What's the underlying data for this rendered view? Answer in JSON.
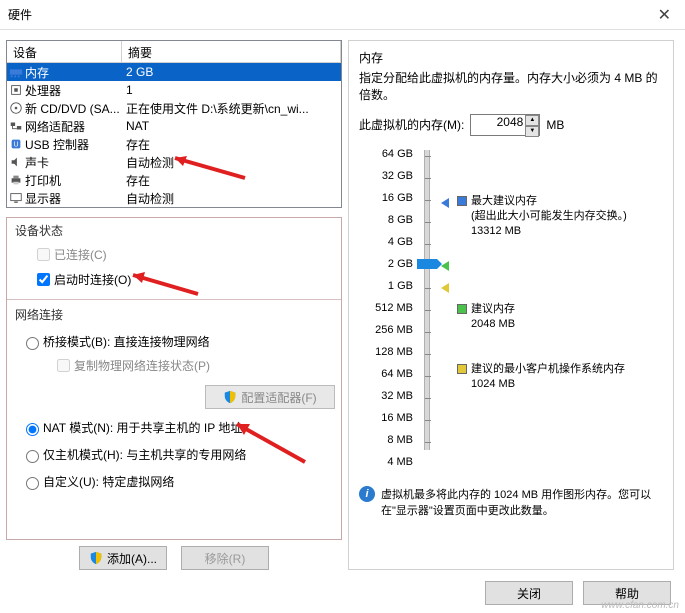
{
  "window": {
    "title": "硬件"
  },
  "device_table": {
    "col_device": "设备",
    "col_summary": "摘要",
    "rows": [
      {
        "icon": "ram",
        "device": "内存",
        "summary": "2 GB",
        "selected": true
      },
      {
        "icon": "cpu",
        "device": "处理器",
        "summary": "1"
      },
      {
        "icon": "cd",
        "device": "新 CD/DVD (SA...",
        "summary": "正在使用文件 D:\\系统更新\\cn_wi..."
      },
      {
        "icon": "net",
        "device": "网络适配器",
        "summary": "NAT"
      },
      {
        "icon": "usb",
        "device": "USB 控制器",
        "summary": "存在"
      },
      {
        "icon": "sound",
        "device": "声卡",
        "summary": "自动检测"
      },
      {
        "icon": "printer",
        "device": "打印机",
        "summary": "存在"
      },
      {
        "icon": "display",
        "device": "显示器",
        "summary": "自动检测"
      }
    ]
  },
  "status": {
    "group": "设备状态",
    "connected": "已连接(C)",
    "connect_on_start": "启动时连接(O)",
    "net_group": "网络连接",
    "bridge": "桥接模式(B): 直接连接物理网络",
    "replicate": "复制物理网络连接状态(P)",
    "config_adapter": "配置适配器(F)",
    "nat": "NAT 模式(N): 用于共享主机的 IP 地址",
    "hostonly": "仅主机模式(H): 与主机共享的专用网络",
    "custom": "自定义(U): 特定虚拟网络"
  },
  "memory": {
    "header": "内存",
    "desc": "指定分配给此虚拟机的内存量。内存大小必须为 4 MB 的倍数。",
    "label": "此虚拟机的内存(M):",
    "value": "2048",
    "unit": "MB",
    "ticks": [
      {
        "label": "64 GB"
      },
      {
        "label": "32 GB"
      },
      {
        "label": "16 GB"
      },
      {
        "label": "8 GB"
      },
      {
        "label": "4 GB"
      },
      {
        "label": "2 GB"
      },
      {
        "label": "1 GB"
      },
      {
        "label": "512 MB"
      },
      {
        "label": "256 MB"
      },
      {
        "label": "128 MB"
      },
      {
        "label": "64 MB"
      },
      {
        "label": "32 MB"
      },
      {
        "label": "16 MB"
      },
      {
        "label": "8 MB"
      },
      {
        "label": "4 MB"
      }
    ],
    "legend_max_title": "最大建议内存",
    "legend_max_note": "(超出此大小可能发生内存交换。)",
    "legend_max_val": "13312 MB",
    "legend_rec_title": "建议内存",
    "legend_rec_val": "2048 MB",
    "legend_min_title": "建议的最小客户机操作系统内存",
    "legend_min_val": "1024 MB",
    "info": "虚拟机最多将此内存的 1024 MB 用作图形内存。您可以在\"显示器\"设置页面中更改此数量。"
  },
  "buttons": {
    "add": "添加(A)...",
    "remove": "移除(R)",
    "close": "关闭",
    "help": "帮助"
  },
  "chart_data": {
    "type": "bar",
    "title": "虚拟机内存分配滑块",
    "ylabel": "内存",
    "current_value_mb": 2048,
    "ticks_mb": [
      65536,
      32768,
      16384,
      8192,
      4096,
      2048,
      1024,
      512,
      256,
      128,
      64,
      32,
      16,
      8,
      4
    ],
    "markers": [
      {
        "name": "最大建议内存",
        "value_mb": 13312,
        "color": "#3a7ad8"
      },
      {
        "name": "建议内存",
        "value_mb": 2048,
        "color": "#4bc24b"
      },
      {
        "name": "建议的最小客户机操作系统内存",
        "value_mb": 1024,
        "color": "#e0c838"
      }
    ]
  },
  "watermark": "www.cfan.com.cn"
}
